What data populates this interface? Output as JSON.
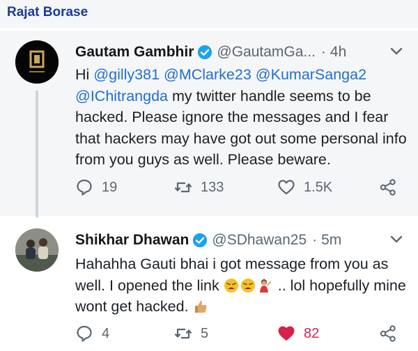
{
  "header": {
    "title": "Rajat Borase"
  },
  "tweets": [
    {
      "display_name": "Gautam Gambhir",
      "handle": "@GautamGa...",
      "time": "4h",
      "text": {
        "w1": "Hi",
        "m1": "@gilly381",
        "m2": "@MClarke23",
        "m3": "@KumarSanga2",
        "m4": "@IChitrangda",
        "rest": "my twitter handle seems to be hacked. Please ignore the messages and I fear that hackers may have got out some personal info from you guys as well. Please beware."
      },
      "replies": "19",
      "retweets": "133",
      "likes": "1.5K",
      "liked": false
    },
    {
      "display_name": "Shikhar Dhawan",
      "handle": "@SDhawan25",
      "time": "5m",
      "text": {
        "part1": "Hahahha Gauti bhai i got message from you as well. I opened the link",
        "part2": ".. lol hopefully mine wont get hacked."
      },
      "replies": "4",
      "retweets": "5",
      "likes": "82",
      "liked": true
    }
  ],
  "colors": {
    "header": "#1d3c8a",
    "mention": "#1f6fd1",
    "verified": "#1da1f2",
    "like": "#d8214a",
    "muted": "#5b6670"
  },
  "icons": [
    "verified-badge-icon",
    "chevron-down-icon",
    "reply-icon",
    "retweet-icon",
    "heart-icon",
    "share-icon",
    "weary-face-emoji",
    "person-emoji",
    "thumbs-up-emoji"
  ]
}
